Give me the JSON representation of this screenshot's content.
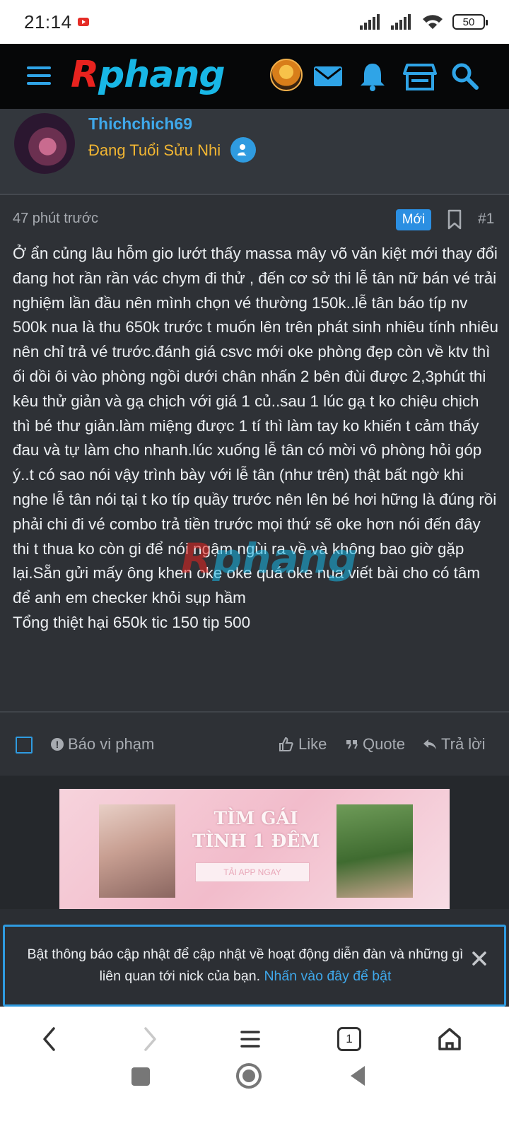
{
  "status": {
    "time": "21:14",
    "battery": "50"
  },
  "header": {
    "logo_r": "R",
    "logo_rest": "phang"
  },
  "profile": {
    "username": "Thichchich69",
    "title": "Đang Tuổi Sửu Nhi"
  },
  "post": {
    "time": "47 phút trước",
    "badge": "Mới",
    "number": "#1",
    "body": "Ở ẩn củng lâu hỗm gio lướt thấy massa mây võ văn kiệt mới thay đổi đang hot rần rần vác chym đi thử , đến cơ sở thi lễ tân nữ bán vé trải nghiệm lần đầu nên mình chọn vé thường 150k..lễ tân báo típ nv 500k nua là thu 650k trước t muốn lên trên phát sinh nhiêu tính nhiêu nên chỉ trả vé trước.đánh giá csvc mới oke phòng đẹp còn về ktv thì ối dồi ôi vào phòng ngồi dưới chân nhấn 2 bên đùi được 2,3phút thi kêu thử giản và gạ chịch với giá 1 củ..sau 1 lúc gạ t ko chiệu chịch thì bé thư giản.làm miệng được 1 tí thì làm tay ko khiến t cảm thấy đau và tự làm cho nhanh.lúc xuống lễ tân có mời vô phòng hỏi góp ý..t có sao nói vậy trình bày với lễ tân (như trên) thật bất ngờ khi nghe lễ tân nói tại t ko típ quầy trước nên lên bé hơi hững là đúng rồi phải chi đi vé combo trả tiền trước mọi thứ sẽ oke hơn nói đến đây thi t thua ko còn gi để nói ngậm ngùi ra về và không bao giờ gặp lại.Sẵn gửi mấy ông khen oke oke quá oke nua viết bài cho có tâm để anh em checker khỏi sụp hầm\nTổng thiệt hại 650k tic 150 tip 500",
    "watermark_r": "R",
    "watermark_rest": "phang"
  },
  "actions": {
    "report": "Báo vi phạm",
    "like": "Like",
    "quote": "Quote",
    "reply": "Trả lời"
  },
  "ad": {
    "title_line1": "TÌM GÁI",
    "title_line2": "TÌNH 1 ĐÊM",
    "button": "TẢI APP NGAY"
  },
  "notice": {
    "text": "Bật thông báo cập nhật để cập nhật về hoạt động diễn đàn và những gì liên quan tới nick của bạn. ",
    "link": "Nhấn vào đây để bật"
  },
  "browser": {
    "tab_count": "1"
  },
  "colors": {
    "accent": "#2f9be0",
    "username": "#3fa8ea",
    "title": "#f2b632",
    "bg": "#2e3136"
  }
}
